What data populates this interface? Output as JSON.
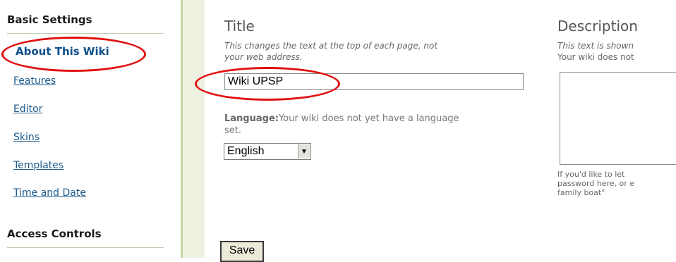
{
  "sidebar": {
    "basic_heading": "Basic Settings",
    "items": [
      {
        "label": "About This Wiki",
        "active": true
      },
      {
        "label": "Features"
      },
      {
        "label": "Editor"
      },
      {
        "label": "Skins"
      },
      {
        "label": "Templates"
      },
      {
        "label": "Time and Date"
      }
    ],
    "access_heading": "Access Controls"
  },
  "title_field": {
    "heading": "Title",
    "help_line1": "This changes the text at the top of each page, not",
    "help_line2": "your web address.",
    "value": "Wiki UPSP"
  },
  "language": {
    "label_bold": "Language:",
    "label_rest": "Your wiki does not yet have a language",
    "label_line2": "set.",
    "selected": "English"
  },
  "description_field": {
    "heading": "Description",
    "help_line1": "This text is shown",
    "help_line2": "Your wiki does not",
    "note_line1": "If you'd like to let",
    "note_line2": "password here, or e",
    "note_line3": "family boat\""
  },
  "buttons": {
    "save_label": "Save"
  },
  "colors": {
    "link": "#1c5a8c",
    "annotation_red": "#e01010",
    "divider_green": "#c7d7a6"
  }
}
